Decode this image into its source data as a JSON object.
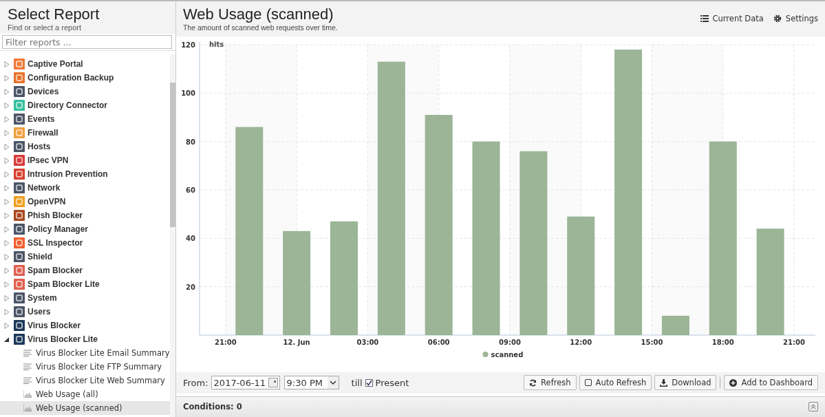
{
  "sidebar": {
    "title": "Select Report",
    "subtitle": "Find or select a report",
    "filter": {
      "placeholder": "Filter reports ..."
    },
    "items": [
      {
        "label": "Captive Portal",
        "color": "#f07c3a",
        "expanded": false
      },
      {
        "label": "Configuration Backup",
        "color": "#e8732c",
        "expanded": false
      },
      {
        "label": "Devices",
        "color": "#4c5566",
        "expanded": false
      },
      {
        "label": "Directory Connector",
        "color": "#35c0a0",
        "expanded": false
      },
      {
        "label": "Events",
        "color": "#4c5566",
        "expanded": false
      },
      {
        "label": "Firewall",
        "color": "#f0a040",
        "expanded": false
      },
      {
        "label": "Hosts",
        "color": "#4c5566",
        "expanded": false
      },
      {
        "label": "IPsec VPN",
        "color": "#d83a3a",
        "expanded": false
      },
      {
        "label": "Intrusion Prevention",
        "color": "#d84030",
        "expanded": false
      },
      {
        "label": "Network",
        "color": "#4c5566",
        "expanded": false
      },
      {
        "label": "OpenVPN",
        "color": "#f0a020",
        "expanded": false
      },
      {
        "label": "Phish Blocker",
        "color": "#a84a20",
        "expanded": false
      },
      {
        "label": "Policy Manager",
        "color": "#4c5566",
        "expanded": false
      },
      {
        "label": "SSL Inspector",
        "color": "#f06030",
        "expanded": false
      },
      {
        "label": "Shield",
        "color": "#4c5566",
        "expanded": false
      },
      {
        "label": "Spam Blocker",
        "color": "#e06050",
        "expanded": false
      },
      {
        "label": "Spam Blocker Lite",
        "color": "#e06050",
        "expanded": false
      },
      {
        "label": "System",
        "color": "#4c5566",
        "expanded": false
      },
      {
        "label": "Users",
        "color": "#4c5566",
        "expanded": false
      },
      {
        "label": "Virus Blocker",
        "color": "#1e3a5a",
        "expanded": false
      },
      {
        "label": "Virus Blocker Lite",
        "color": "#1e3a5a",
        "expanded": true,
        "children": [
          {
            "label": "Virus Blocker Lite Email Summary",
            "kind": "text",
            "selected": false
          },
          {
            "label": "Virus Blocker Lite FTP Summary",
            "kind": "text",
            "selected": false
          },
          {
            "label": "Virus Blocker Lite Web Summary",
            "kind": "text",
            "selected": false
          },
          {
            "label": "Web Usage (all)",
            "kind": "chart",
            "selected": false
          },
          {
            "label": "Web Usage (scanned)",
            "kind": "chart",
            "selected": true
          }
        ]
      }
    ]
  },
  "report": {
    "title": "Web Usage (scanned)",
    "description": "The amount of scanned web requests over time.",
    "actions": [
      {
        "label": "Current Data",
        "kind": "list"
      },
      {
        "label": "Settings",
        "kind": "gear"
      }
    ],
    "chart_data": {
      "type": "bar",
      "ylabel": "hits",
      "categories": [
        null,
        "21:00",
        null,
        null,
        "12. Jun",
        null,
        null,
        "03:00",
        null,
        null,
        "06:00",
        null,
        null,
        "09:00",
        null,
        null,
        "12:00",
        null,
        null,
        "15:00",
        null,
        null,
        "18:00",
        null,
        null,
        "21:00"
      ],
      "series": [
        {
          "name": "scanned",
          "color": "#9bb596",
          "values": [
            null,
            null,
            86,
            null,
            43,
            null,
            47,
            null,
            113,
            null,
            91,
            null,
            80,
            null,
            76,
            null,
            49,
            null,
            118,
            null,
            8,
            null,
            80,
            null,
            44,
            null
          ]
        }
      ],
      "ylim": [
        0,
        120
      ],
      "grid": true,
      "yticks": [
        20,
        40,
        60,
        80,
        100,
        120
      ]
    },
    "toolbar": {
      "from_label": "From:",
      "date": "2017-06-11",
      "time": "9:30 PM",
      "till_label": "till",
      "present": {
        "label": "Present",
        "checked": true
      },
      "buttons": [
        {
          "label": "Refresh",
          "kind": "refresh"
        },
        {
          "label": "Auto Refresh",
          "kind": "checkbox"
        },
        {
          "label": "Download",
          "kind": "download"
        },
        {
          "label": "Add to Dashboard",
          "kind": "add"
        }
      ]
    },
    "conditions": "Conditions: 0"
  }
}
